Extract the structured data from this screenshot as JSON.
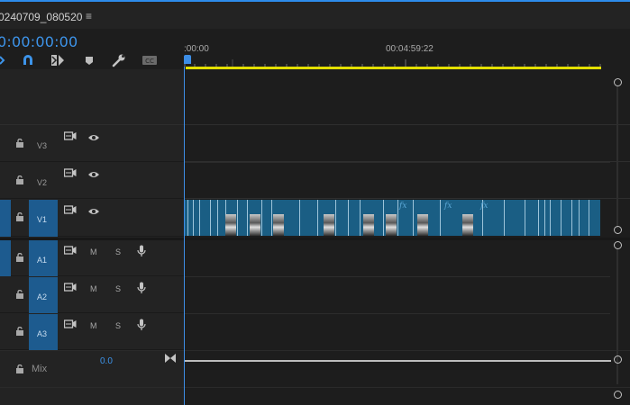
{
  "header": {
    "sequence_name": "0240709_080520",
    "menu_icon": "hamburger-menu-icon"
  },
  "timecode": "0:00:00:00",
  "toolbar": {
    "icons": [
      "insert-overwrite-icon",
      "snap-magnet-icon",
      "linked-selection-icon",
      "add-marker-icon",
      "timeline-settings-wrench-icon",
      "captions-icon"
    ]
  },
  "ruler": {
    "labels": [
      ":00:00",
      "00:04:59:22"
    ]
  },
  "video_tracks": [
    {
      "name": "V3",
      "targeted": false
    },
    {
      "name": "V2",
      "targeted": false
    },
    {
      "name": "V1",
      "targeted": true
    }
  ],
  "audio_tracks": [
    {
      "name": "A1",
      "mute": "M",
      "solo": "S"
    },
    {
      "name": "A2",
      "mute": "M",
      "solo": "S"
    },
    {
      "name": "A3",
      "mute": "M",
      "solo": "S"
    }
  ],
  "mix": {
    "label": "Mix",
    "value": "0.0"
  },
  "clip": {
    "fx_label": "fx"
  },
  "colors": {
    "accent": "#3d94ea",
    "clip": "#1a5e84",
    "target": "#1d5b8f",
    "work_area": "#e3df00"
  }
}
